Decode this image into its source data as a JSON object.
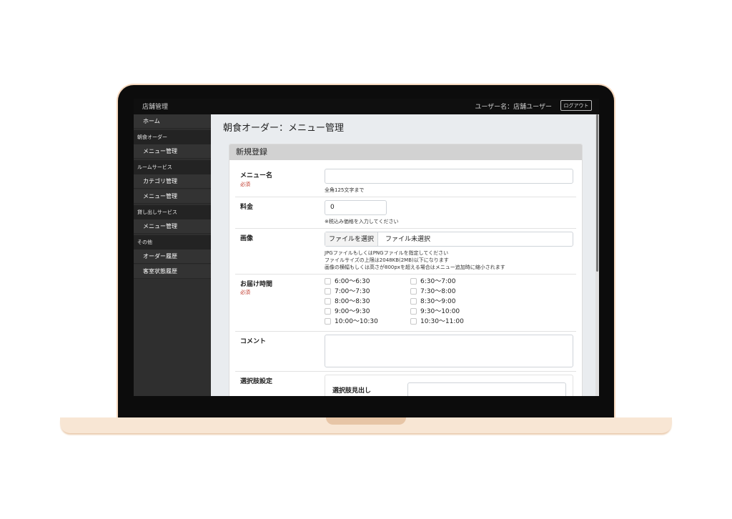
{
  "header": {
    "store": "店舗管理",
    "user": "ユーザー名：店舗ユーザー",
    "logout": "ログアウト"
  },
  "sidebar": {
    "home": "ホーム",
    "groups": [
      {
        "label": "朝食オーダー",
        "items": [
          "メニュー管理"
        ]
      },
      {
        "label": "ルームサービス",
        "items": [
          "カテゴリ管理",
          "メニュー管理"
        ]
      },
      {
        "label": "貸し出しサービス",
        "items": [
          "メニュー管理"
        ]
      },
      {
        "label": "その他",
        "items": [
          "オーダー履歴",
          "客室状態履歴"
        ]
      }
    ]
  },
  "main": {
    "title": "朝食オーダー：メニュー管理",
    "card_title": "新規登録",
    "required": "必須",
    "menu_name": {
      "label": "メニュー名",
      "value": "",
      "hint": "全角125文字まで"
    },
    "price": {
      "label": "料金",
      "value": "0",
      "hint": "※税込み価格を入力してください"
    },
    "image": {
      "label": "画像",
      "button": "ファイルを選択",
      "status": "ファイル未選択",
      "hints": [
        "JPGファイルもしくはPNGファイルを指定してください",
        "ファイルサイズの上限は2048KB(2MB)以下になります",
        "画像の横幅もしくは高さが800pxを超える場合はメニュー追加時に縮小されます"
      ]
    },
    "delivery": {
      "label": "お届け時間",
      "slots": [
        "6:00〜6:30",
        "6:30〜7:00",
        "7:00〜7:30",
        "7:30〜8:00",
        "8:00〜8:30",
        "8:30〜9:00",
        "9:00〜9:30",
        "9:30〜10:00",
        "10:00〜10:30",
        "10:30〜11:00"
      ]
    },
    "comment": {
      "label": "コメント",
      "value": ""
    },
    "options": {
      "label": "選択肢設定",
      "heading": "選択肢見出し",
      "value": ""
    }
  }
}
